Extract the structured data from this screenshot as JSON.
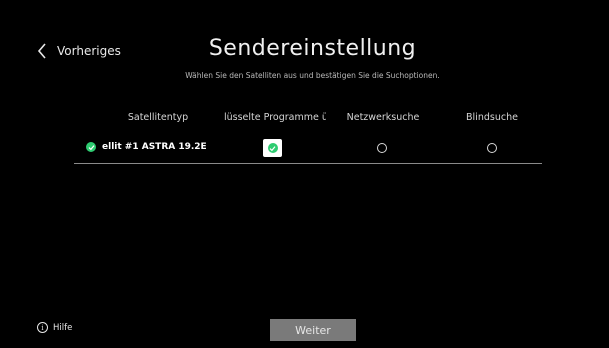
{
  "header": {
    "back_label": "Vorheriges",
    "title": "Sendereinstellung",
    "subtitle": "Wählen Sie den Satelliten aus und bestätigen Sie die Suchoptionen."
  },
  "table": {
    "columns": [
      "Satellitentyp",
      "lüsselte Programme ü",
      "Netzwerksuche",
      "Blindsuche"
    ],
    "rows": [
      {
        "satellite": "ellit #1 ASTRA 19.2E",
        "selected": true,
        "encrypted_programs": true,
        "network_search": false,
        "blind_search": false
      }
    ]
  },
  "footer": {
    "help_label": "Hilfe",
    "next_label": "Weiter"
  },
  "colors": {
    "accent_green": "#2ecc71",
    "button_gray": "#7a7a7a"
  },
  "icons": {
    "back": "chevron-left-icon",
    "selected": "check-circle-icon",
    "help": "info-icon"
  }
}
